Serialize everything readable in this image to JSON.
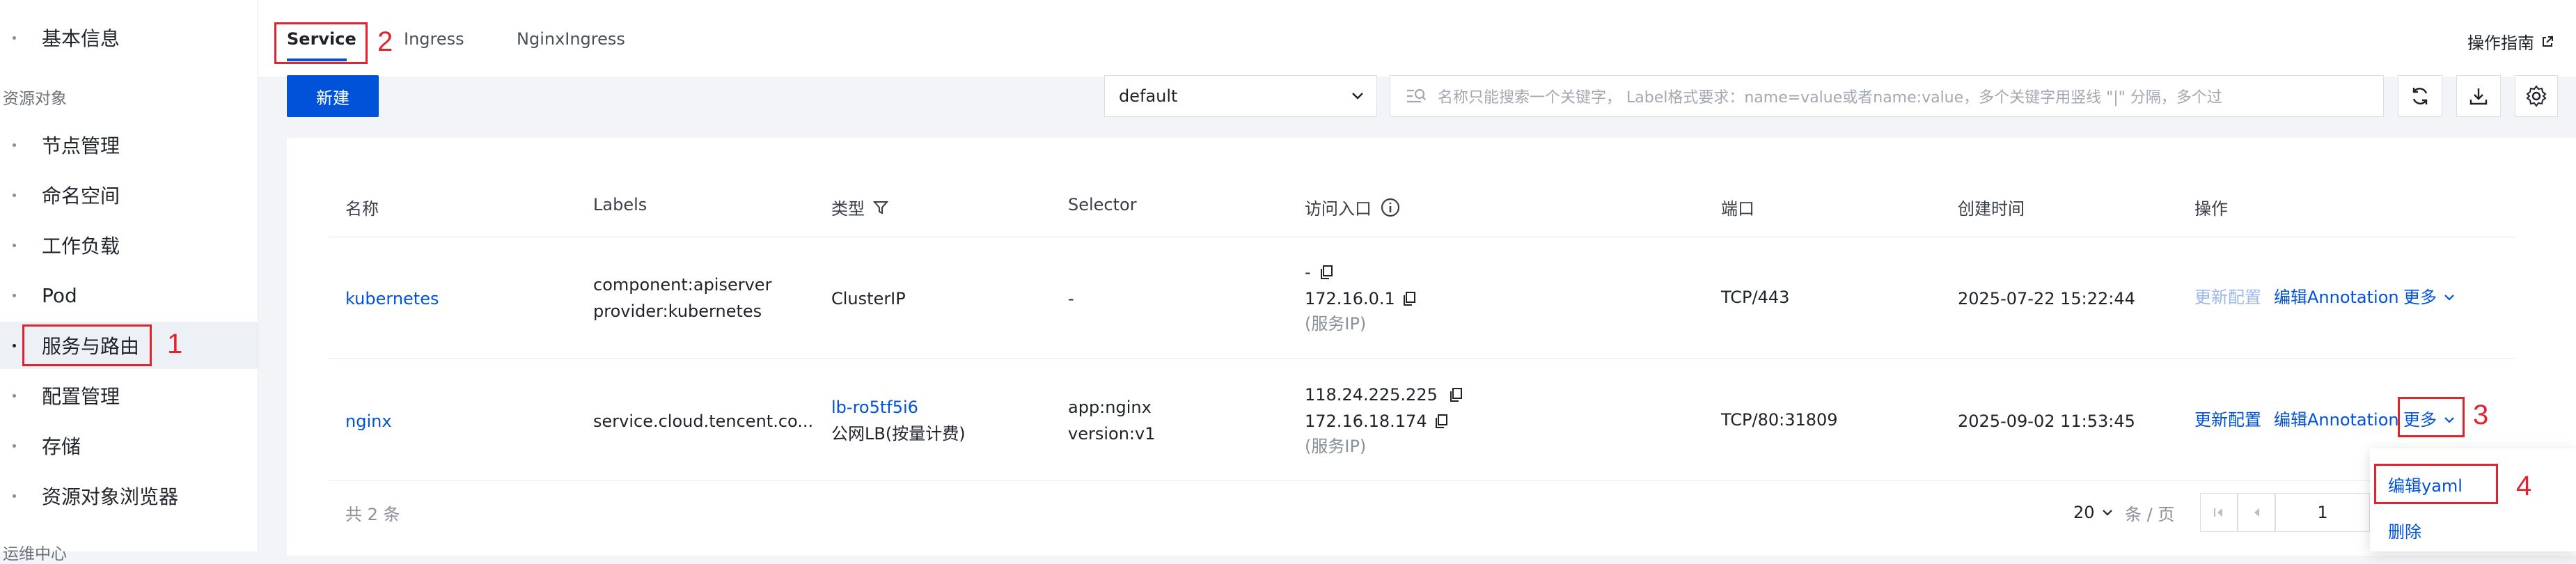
{
  "sidebar": {
    "items_top": [
      "基本信息"
    ],
    "section_title": "资源对象",
    "items": [
      "节点管理",
      "命名空间",
      "工作负载",
      "Pod",
      "服务与路由",
      "配置管理",
      "存储",
      "资源对象浏览器"
    ],
    "active_item": "服务与路由",
    "section_bottom": "运维中心"
  },
  "annotations": [
    "1",
    "2",
    "3",
    "4"
  ],
  "tabs": [
    "Service",
    "Ingress",
    "NginxIngress"
  ],
  "header": {
    "guide_link": "操作指南"
  },
  "toolbar": {
    "new_button": "新建",
    "namespace_select": "default",
    "search_placeholder": "名称只能搜索一个关键字， Label格式要求：name=value或者name:value，多个关键字用竖线 \"|\" 分隔，多个过"
  },
  "icons": {
    "refresh": "refresh-icon",
    "download": "download-icon",
    "settings": "gear-icon",
    "filter": "filter-icon",
    "info": "info-circle-icon",
    "copy": "copy-icon",
    "external": "external-link-icon",
    "search": "search-list-icon"
  },
  "colors": {
    "primary": "#0052d9",
    "annotation": "#e0242f",
    "disabled_link": "#9db8ec"
  },
  "table": {
    "columns": [
      "名称",
      "Labels",
      "类型",
      "Selector",
      "访问入口",
      "端口",
      "创建时间",
      "操作"
    ],
    "rows": [
      {
        "name": "kubernetes",
        "labels": [
          "component:apiserver",
          "provider:kubernetes"
        ],
        "type": [
          "ClusterIP"
        ],
        "selector": [
          "-"
        ],
        "access": [
          "-",
          "172.16.0.1",
          "(服务IP)"
        ],
        "port": "TCP/443",
        "created": "2025-07-22 15:22:44",
        "actions": {
          "update": "更新配置",
          "edit_annotation": "编辑Annotation",
          "more": "更多"
        }
      },
      {
        "name": "nginx",
        "labels": [
          "service.cloud.tencent.co..."
        ],
        "type": [
          "lb-ro5tf5i6",
          "公网LB(按量计费)"
        ],
        "selector": [
          "app:nginx",
          "version:v1"
        ],
        "access": [
          "118.24.225.225",
          "172.16.18.174",
          "(服务IP)"
        ],
        "port": "TCP/80:31809",
        "created": "2025-09-02 11:53:45",
        "actions": {
          "update": "更新配置",
          "edit_annotation": "编辑Annotation",
          "more": "更多"
        }
      }
    ]
  },
  "footer": {
    "total": "共 2 条",
    "page_size": "20",
    "page_size_unit": "条 / 页",
    "page_number": "1"
  },
  "more_menu": {
    "items": [
      "编辑yaml",
      "删除"
    ]
  }
}
